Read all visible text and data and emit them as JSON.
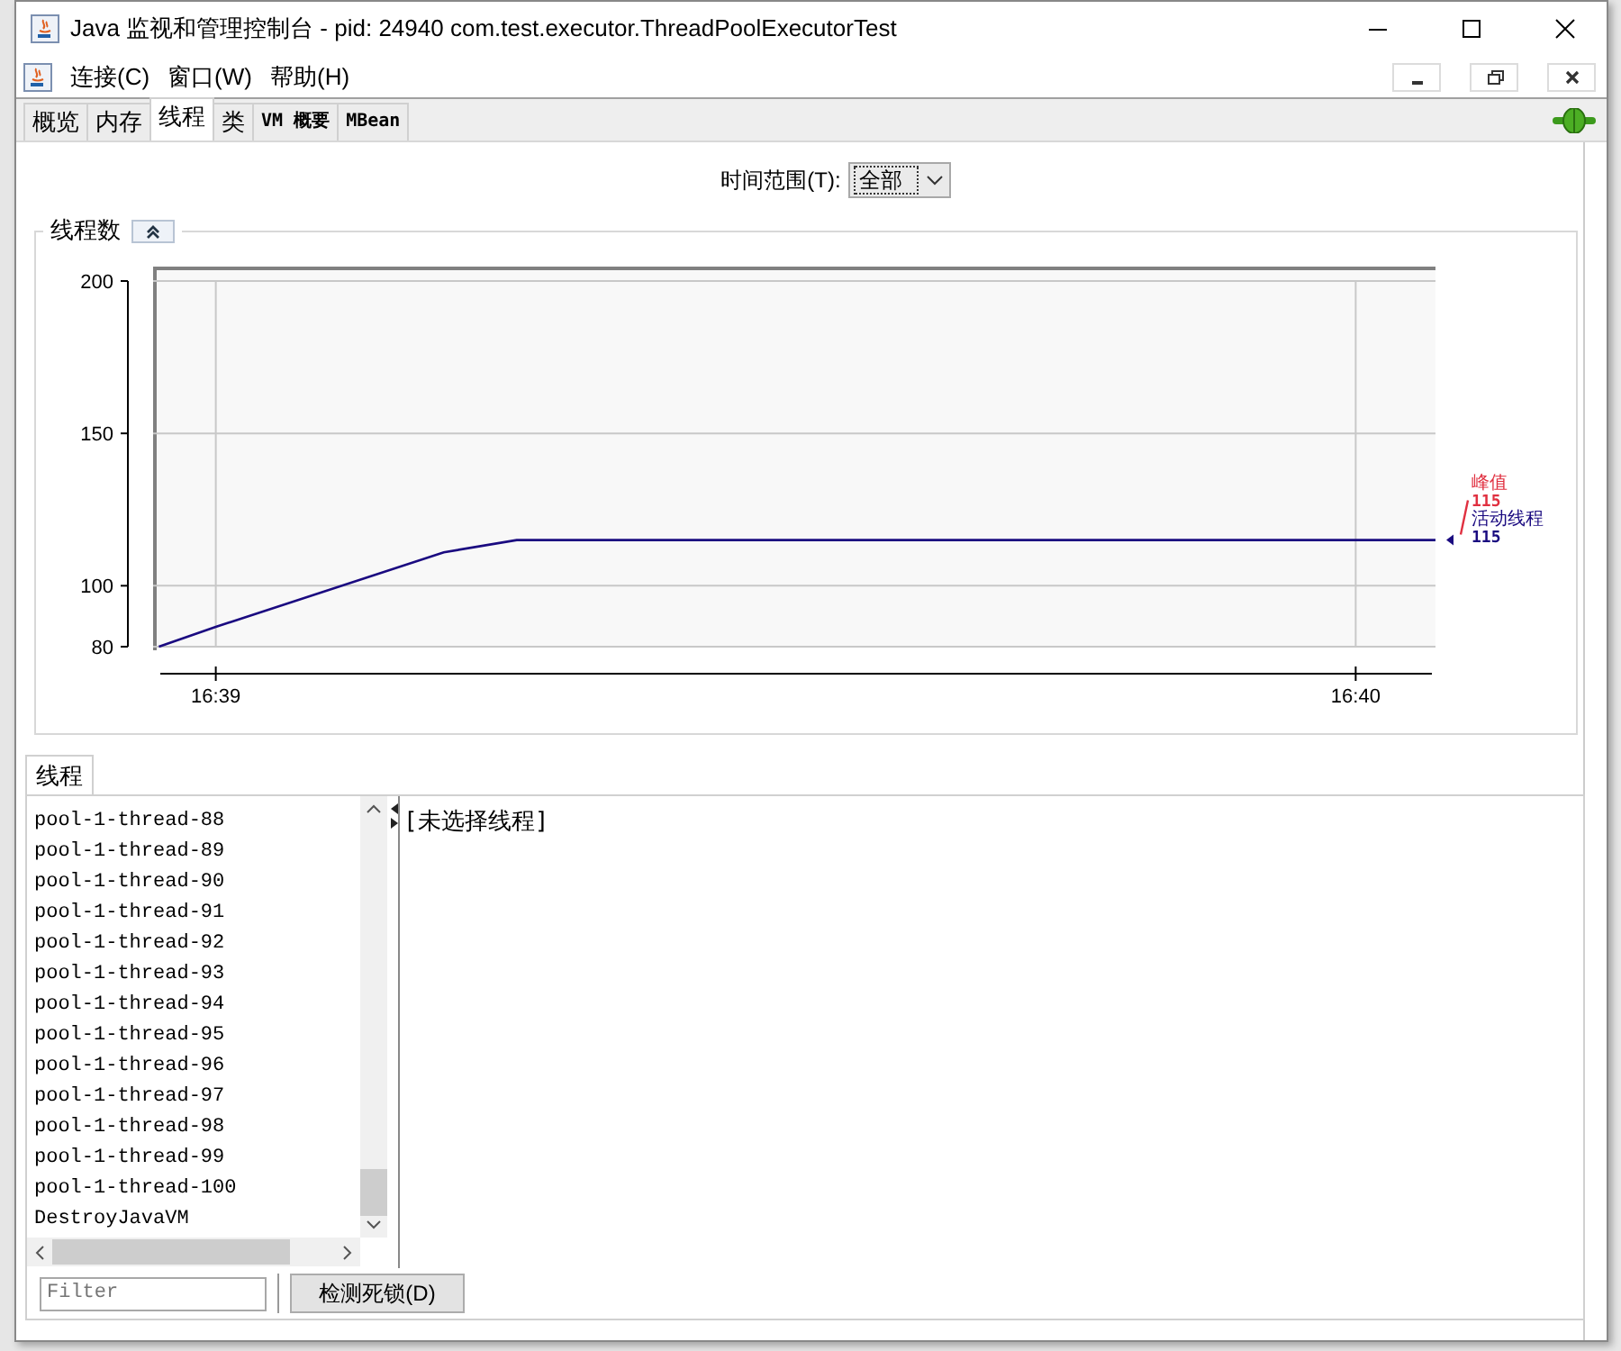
{
  "window": {
    "title": "Java 监视和管理控制台 - pid: 24940 com.test.executor.ThreadPoolExecutorTest"
  },
  "menu": [
    "连接(C)",
    "窗口(W)",
    "帮助(H)"
  ],
  "tabs": [
    {
      "label": "概览",
      "selected": false
    },
    {
      "label": "内存",
      "selected": false
    },
    {
      "label": "线程",
      "selected": true
    },
    {
      "label": "类",
      "selected": false
    },
    {
      "label": "VM 概要",
      "selected": false
    },
    {
      "label": "MBean",
      "selected": false
    }
  ],
  "time_range": {
    "label": "时间范围(T):",
    "value": "全部"
  },
  "chart_panel": {
    "title": "线程数",
    "chart_data": {
      "type": "line",
      "grid": true,
      "x": [
        998.95,
        999,
        999.2,
        999.264,
        1000.07
      ],
      "series": [
        {
          "name": "活动线程",
          "color": "#1a0a80",
          "values": [
            80,
            86.5,
            111,
            115,
            115
          ]
        }
      ],
      "xlim": [
        998.945,
        1000.07
      ],
      "ylim": [
        80,
        200
      ],
      "xticks": [
        {
          "value": 999,
          "label": "16:39"
        },
        {
          "value": 1000,
          "label": "16:40"
        }
      ],
      "yticks": [
        80,
        100,
        150,
        200
      ]
    },
    "peak": {
      "label": "峰值",
      "value": "115",
      "color": "#e03040"
    },
    "current_value": "115"
  },
  "threads_panel": {
    "tab": "线程",
    "items": [
      "pool-1-thread-88",
      "pool-1-thread-89",
      "pool-1-thread-90",
      "pool-1-thread-91",
      "pool-1-thread-92",
      "pool-1-thread-93",
      "pool-1-thread-94",
      "pool-1-thread-95",
      "pool-1-thread-96",
      "pool-1-thread-97",
      "pool-1-thread-98",
      "pool-1-thread-99",
      "pool-1-thread-100",
      "DestroyJavaVM"
    ],
    "detail": "[未选择线程]",
    "filter": {
      "placeholder": "Filter"
    },
    "button": "检测死锁(D)"
  }
}
